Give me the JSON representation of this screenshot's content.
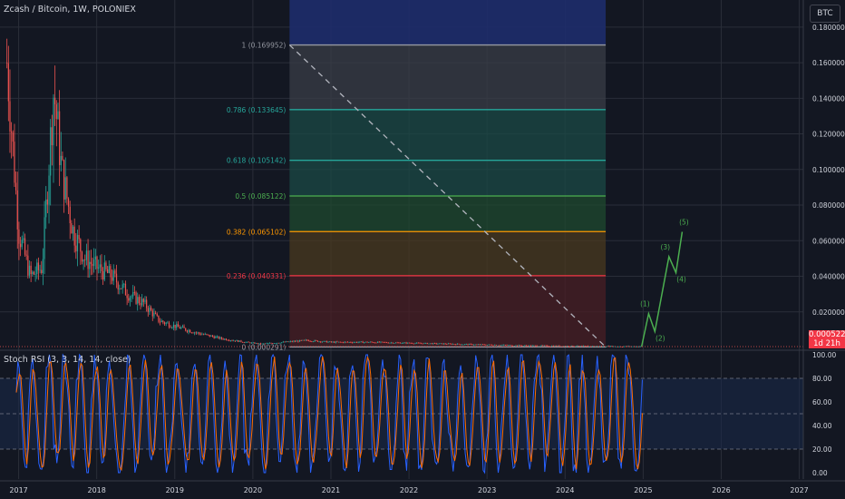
{
  "header": {
    "symbol": "Zcash / Bitcoin, 1W, POLONIEX",
    "currency_button": "BTC"
  },
  "price_tag": {
    "price": "0.000522",
    "countdown": "1d 21h"
  },
  "rsi_header": "Stoch RSI (3, 3, 14, 14, close)",
  "colors": {
    "background": "#131722",
    "grid": "#2a2e39",
    "up": "#26a69a",
    "down": "#ef5350",
    "fib_1": "#9598a1",
    "fib_0786": "#26a69a",
    "fib_0618": "#26a69a",
    "fib_05": "#4caf50",
    "fib_0382": "#ff9800",
    "fib_0236": "#f23645",
    "wave": "#4caf50",
    "k_line": "#2962ff",
    "d_line": "#ff6d00"
  },
  "chart_data": [
    {
      "type": "line",
      "title": "Zcash / Bitcoin, 1W, POLONIEX",
      "x_ticks": [
        "2017",
        "2018",
        "2019",
        "2020",
        "2021",
        "2022",
        "2023",
        "2024",
        "2025",
        "2026",
        "2027"
      ],
      "y_ticks": [
        "0.180000",
        "0.160000",
        "0.140000",
        "0.120000",
        "0.100000",
        "0.080000",
        "0.060000",
        "0.040000",
        "0.020000"
      ],
      "ylim": [
        0,
        0.19
      ],
      "price_path": {
        "x": [
          2016.85,
          2017.0,
          2017.15,
          2017.3,
          2017.45,
          2017.55,
          2017.7,
          2017.85,
          2018.0,
          2018.2,
          2018.4,
          2018.6,
          2018.8,
          2019.0,
          2019.3,
          2019.6,
          2019.9,
          2020.1,
          2020.4,
          2020.7,
          2021.0,
          2021.5,
          2022.0,
          2022.5,
          2023.0,
          2023.5,
          2024.0,
          2024.5,
          2025.0
        ],
        "y": [
          0.16,
          0.065,
          0.04,
          0.045,
          0.145,
          0.1,
          0.065,
          0.05,
          0.045,
          0.04,
          0.03,
          0.025,
          0.015,
          0.012,
          0.008,
          0.005,
          0.003,
          0.002,
          0.003,
          0.004,
          0.003,
          0.003,
          0.0025,
          0.002,
          0.0015,
          0.001,
          0.0008,
          0.0006,
          0.000522
        ]
      },
      "fibonacci": {
        "range_x": [
          2020.47,
          2024.52
        ],
        "levels": [
          {
            "ratio": "1",
            "value": 0.169952,
            "label": "1 (0.169952)"
          },
          {
            "ratio": "0.786",
            "value": 0.133645,
            "label": "0.786 (0.133645)"
          },
          {
            "ratio": "0.618",
            "value": 0.105142,
            "label": "0.618 (0.105142)"
          },
          {
            "ratio": "0.5",
            "value": 0.085122,
            "label": "0.5 (0.085122)"
          },
          {
            "ratio": "0.382",
            "value": 0.065102,
            "label": "0.382 (0.065102)"
          },
          {
            "ratio": "0.236",
            "value": 0.040331,
            "label": "0.236 (0.040331)"
          },
          {
            "ratio": "0",
            "value": 0.000291,
            "label": "0 (0.000291)"
          }
        ]
      },
      "elliott_waves": {
        "x": [
          2024.98,
          2025.07,
          2025.15,
          2025.33,
          2025.42,
          2025.5
        ],
        "y": [
          0.000522,
          0.019,
          0.009,
          0.051,
          0.042,
          0.065
        ],
        "labels": [
          "(1)",
          "(2)",
          "(3)",
          "(4)",
          "(5)"
        ]
      }
    },
    {
      "type": "line",
      "title": "Stoch RSI (3, 3, 14, 14, close)",
      "y_ticks": [
        "100.00",
        "80.00",
        "60.00",
        "40.00",
        "20.00",
        "0.00"
      ],
      "ylim": [
        0,
        100
      ],
      "bands": [
        80,
        50,
        20
      ]
    }
  ]
}
